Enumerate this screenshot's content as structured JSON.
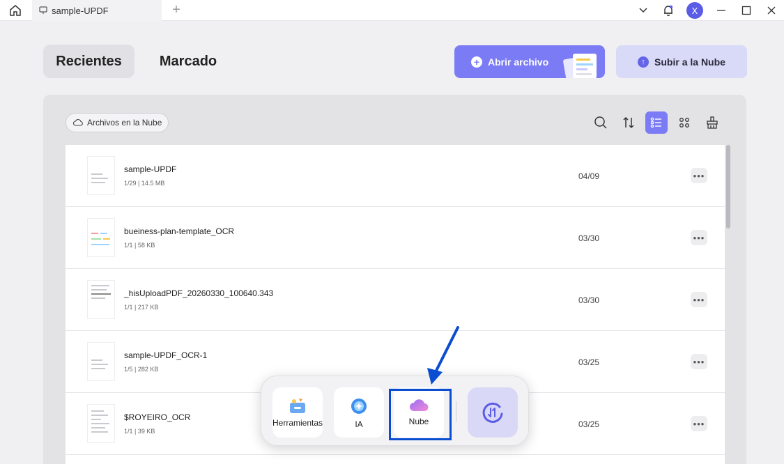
{
  "titlebar": {
    "tab_title": "sample-UPDF",
    "avatar_letter": "X"
  },
  "header": {
    "tab_recent": "Recientes",
    "tab_marked": "Marcado",
    "open_file": "Abrir archivo",
    "upload_cloud": "Subir a la Nube"
  },
  "panel": {
    "cloud_filter": "Archivos en la Nube"
  },
  "files": [
    {
      "name": "sample-UPDF",
      "meta": "1/29 | 14.5 MB",
      "date": "04/09"
    },
    {
      "name": "bueiness-plan-template_OCR",
      "meta": "1/1 | 58 KB",
      "date": "03/30"
    },
    {
      "name": "_hisUploadPDF_20260330_100640.343",
      "meta": "1/1 | 217 KB",
      "date": "03/30"
    },
    {
      "name": "sample-UPDF_OCR-1",
      "meta": "1/5 | 282 KB",
      "date": "03/25"
    },
    {
      "name": "$ROYEIRO_OCR",
      "meta": "1/1 | 39 KB",
      "date": "03/25"
    }
  ],
  "dock": {
    "tools": "Herramientas",
    "ai": "IA",
    "cloud": "Nube"
  },
  "colors": {
    "accent": "#7b7cf5",
    "highlight": "#0b4dd1"
  }
}
